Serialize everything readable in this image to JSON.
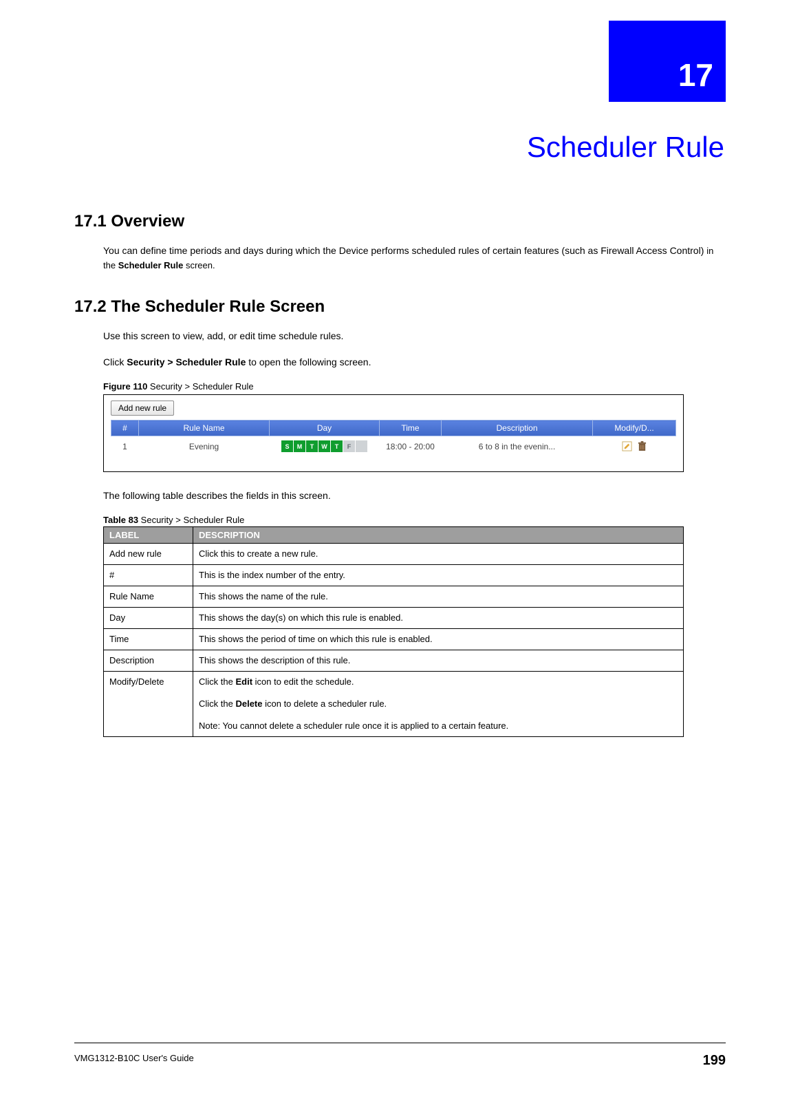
{
  "chapter": {
    "number": "17",
    "title": "Scheduler Rule"
  },
  "section1": {
    "heading": "17.1  Overview",
    "body_pre": "You can define time periods and days during which the Device performs scheduled rules of certain features (such as Firewall Access Control) ",
    "body_in": "in the ",
    "body_bold": "Scheduler Rule",
    "body_post": " screen."
  },
  "section2": {
    "heading": "17.2  The Scheduler Rule Screen",
    "intro1": "Use this screen to view, add, or edit time schedule rules.",
    "intro2_pre": "Click ",
    "intro2_bold": "Security >  Scheduler Rule",
    "intro2_post": " to open the following screen.",
    "figure_label_num": "Figure 110",
    "figure_label_text": "   Security > Scheduler Rule",
    "screenshot": {
      "add_button": "Add new rule",
      "headers": [
        "#",
        "Rule Name",
        "Day",
        "Time",
        "Description",
        "Modify/D..."
      ],
      "row": {
        "num": "1",
        "name": "Evening",
        "days": [
          {
            "label": "S",
            "on": true
          },
          {
            "label": "M",
            "on": true
          },
          {
            "label": "T",
            "on": true
          },
          {
            "label": "W",
            "on": true
          },
          {
            "label": "T",
            "on": true
          },
          {
            "label": "F",
            "on": false
          },
          {
            "label": "",
            "on": false
          }
        ],
        "time": "18:00 - 20:00",
        "desc": "6 to 8 in the evenin..."
      }
    },
    "after_fig": "The following table describes the fields in this screen.",
    "table_label_num": "Table 83",
    "table_label_text": "   Security > Scheduler Rule",
    "desc_table": {
      "header_label": "LABEL",
      "header_desc": "DESCRIPTION",
      "rows": [
        {
          "label": "Add new rule",
          "desc": "Click this to create a new rule."
        },
        {
          "label": "#",
          "desc": "This is the index number of the entry."
        },
        {
          "label": "Rule Name",
          "desc": "This shows the name of the rule."
        },
        {
          "label": "Day",
          "desc": "This shows the day(s) on which this rule is enabled."
        },
        {
          "label": "Time",
          "desc": "This shows the period of time on which this rule is enabled."
        },
        {
          "label": "Description",
          "desc": "This shows the description of this rule."
        }
      ],
      "modify_row": {
        "label": "Modify/Delete",
        "p1_pre": "Click the ",
        "p1_bold": "Edit",
        "p1_post": " icon to edit the schedule.",
        "p2_pre": "Click the ",
        "p2_bold": "Delete",
        "p2_post": " icon to delete a scheduler rule.",
        "p3": "Note: You cannot delete a scheduler rule once it is applied to a certain feature."
      }
    }
  },
  "footer": {
    "guide": "VMG1312-B10C User's Guide",
    "page": "199"
  }
}
